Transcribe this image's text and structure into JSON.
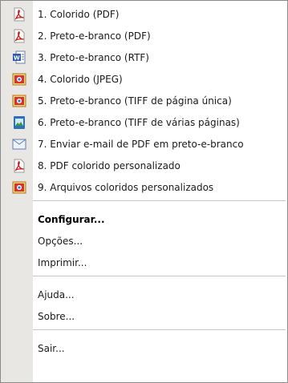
{
  "menu": {
    "items": [
      {
        "label": "1. Colorido (PDF)",
        "icon": "pdf-icon"
      },
      {
        "label": "2. Preto-e-branco (PDF)",
        "icon": "pdf-icon"
      },
      {
        "label": "3. Preto-e-branco (RTF)",
        "icon": "word-doc-icon"
      },
      {
        "label": "4. Colorido (JPEG)",
        "icon": "image-icon"
      },
      {
        "label": "5. Preto-e-branco (TIFF de página única)",
        "icon": "image-icon"
      },
      {
        "label": "6. Preto-e-branco (TIFF de várias páginas)",
        "icon": "multipage-image-icon"
      },
      {
        "label": "7. Enviar e-mail de PDF em preto-e-branco",
        "icon": "envelope-icon"
      },
      {
        "label": "8. PDF colorido personalizado",
        "icon": "pdf-icon"
      },
      {
        "label": "9. Arquivos coloridos personalizados",
        "icon": "image-icon"
      }
    ],
    "configurar": "Configurar...",
    "opcoes": "Opções...",
    "imprimir": "Imprimir...",
    "ajuda": "Ajuda...",
    "sobre": "Sobre...",
    "sair": "Sair..."
  }
}
